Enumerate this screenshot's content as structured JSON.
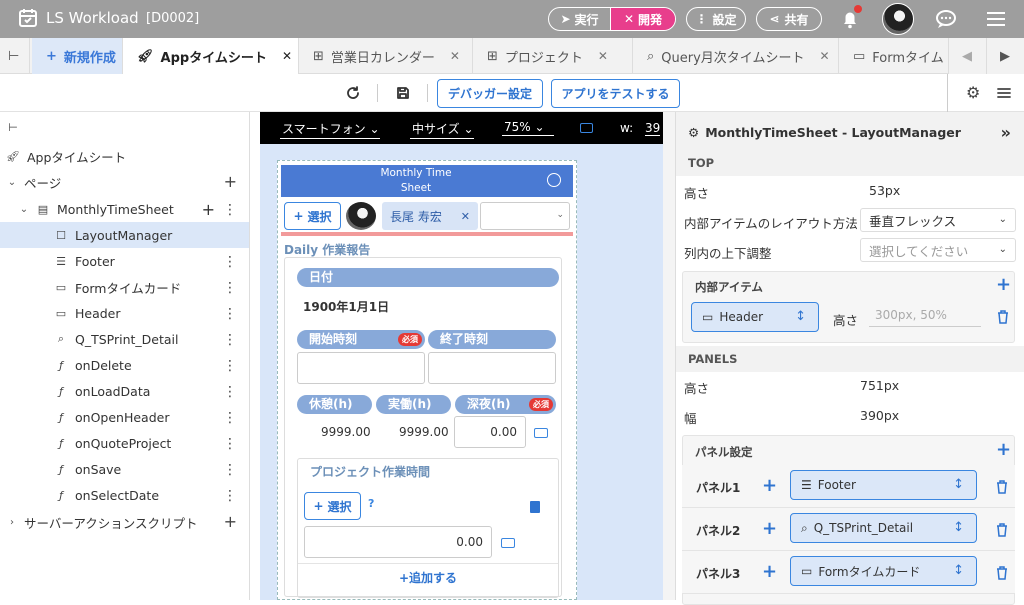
{
  "app": {
    "title": "LS Workload",
    "doc_id": "[D0002]"
  },
  "topbar": {
    "run_label": "実行",
    "dev_label": "開発",
    "settings_label": "設定",
    "share_label": "共有"
  },
  "tabs": {
    "new_label": "新規作成",
    "items": [
      {
        "label": "Appタイムシート",
        "icon": "rocket-icon"
      },
      {
        "label": "営業日カレンダー",
        "icon": "table-icon"
      },
      {
        "label": "プロジェクト",
        "icon": "table-icon"
      },
      {
        "label": "Query月次タイムシート",
        "icon": "search-icon"
      },
      {
        "label": "Formタイム",
        "icon": "form-icon"
      }
    ]
  },
  "toolbar": {
    "debugger_label": "デバッガー設定",
    "test_label": "アプリをテストする"
  },
  "tree": {
    "root": "Appタイムシート",
    "pages": "ページ",
    "page": "MonthlyTimeSheet",
    "items": [
      "LayoutManager",
      "Footer",
      "Formタイムカード",
      "Header",
      "Q_TSPrint_Detail",
      "onDelete",
      "onLoadData",
      "onOpenHeader",
      "onQuoteProject",
      "onSave",
      "onSelectDate"
    ],
    "server": "サーバーアクションスクリプト"
  },
  "preview": {
    "device": "スマートフォン",
    "size": "中サイズ",
    "zoom": "75%",
    "width_label": "w:",
    "width_value": "39",
    "app_title": "Monthly Time Sheet",
    "select_label": "選択",
    "user_name": "長尾 寿宏",
    "section_title": "Daily 作業報告",
    "date_label": "日付",
    "date_value": "1900年1月1日",
    "start_label": "開始時刻",
    "end_label": "終了時刻",
    "required": "必須",
    "rest_label": "休憩(h)",
    "actual_label": "実働(h)",
    "night_label": "深夜(h)",
    "rest_value": "9999.00",
    "actual_value": "9999.00",
    "night_value": "0.00",
    "project_title": "プロジェクト作業時間",
    "project_value": "0.00",
    "help": "?",
    "add_label": "追加する"
  },
  "panel": {
    "title": "MonthlyTimeSheet - LayoutManager",
    "top_section": "TOP",
    "height_label": "高さ",
    "height_value": "53px",
    "layout_label": "内部アイテムのレイアウト方法",
    "layout_value": "垂直フレックス",
    "valign_label": "列内の上下調整",
    "valign_placeholder": "選択してください",
    "inner_items": "内部アイテム",
    "inner_chip": "Header",
    "inner_height_label": "高さ",
    "inner_height_placeholder": "300px, 50%",
    "panels_section": "PANELS",
    "panels_height_label": "高さ",
    "panels_height_value": "751px",
    "panels_width_label": "幅",
    "panels_width_value": "390px",
    "panel_settings": "パネル設定",
    "panel_rows": [
      {
        "label": "パネル1",
        "chip": "Footer"
      },
      {
        "label": "パネル2",
        "chip": "Q_TSPrint_Detail"
      },
      {
        "label": "パネル3",
        "chip": "Formタイムカード"
      }
    ]
  },
  "colors": {
    "accent": "#3a86e0",
    "dev_pink": "#e83e8c",
    "topbar": "#9e9e9e",
    "preview_bg": "#d9e6f9"
  }
}
